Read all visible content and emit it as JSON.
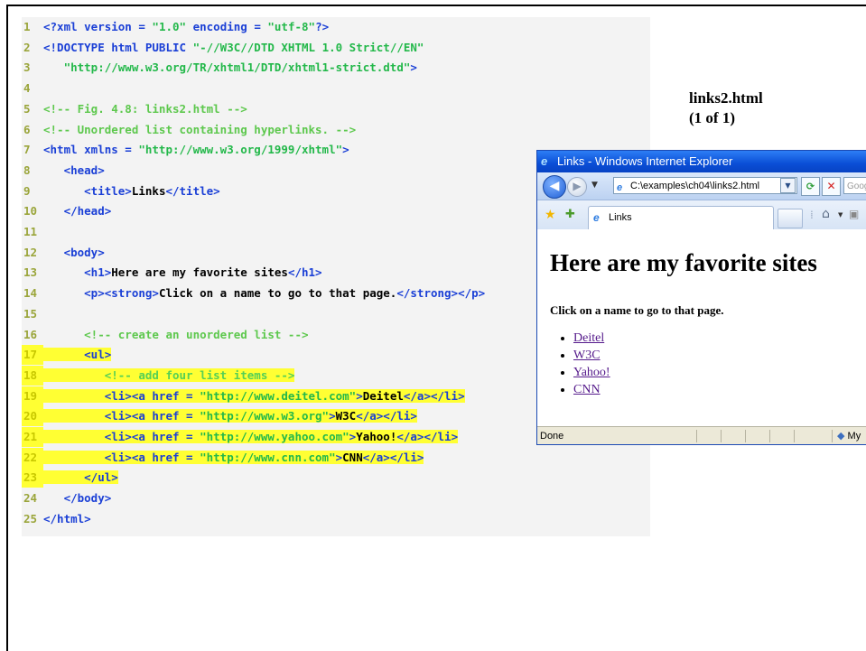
{
  "slide": {
    "title_line1": "links2.html",
    "title_line2": "(1 of 1)"
  },
  "code_lines": [
    {
      "num": "1",
      "hl": false,
      "parts": [
        [
          "tag",
          "<?xml version = "
        ],
        [
          "str",
          "\"1.0\""
        ],
        [
          "tag",
          " encoding = "
        ],
        [
          "str",
          "\"utf-8\""
        ],
        [
          "tag",
          "?>"
        ]
      ]
    },
    {
      "num": "2",
      "hl": false,
      "parts": [
        [
          "tag",
          "<!DOCTYPE html PUBLIC "
        ],
        [
          "str",
          "\"-//W3C//DTD XHTML 1.0 Strict//EN\""
        ]
      ]
    },
    {
      "num": "3",
      "hl": false,
      "parts": [
        [
          "tag",
          "   "
        ],
        [
          "str",
          "\"http://www.w3.org/TR/xhtml1/DTD/xhtml1-strict.dtd\""
        ],
        [
          "tag",
          ">"
        ]
      ]
    },
    {
      "num": "4",
      "hl": false,
      "parts": []
    },
    {
      "num": "5",
      "hl": false,
      "parts": [
        [
          "cmt",
          "<!-- Fig. 4.8: links2.html -->"
        ]
      ]
    },
    {
      "num": "6",
      "hl": false,
      "parts": [
        [
          "cmt",
          "<!-- Unordered list containing hyperlinks. -->"
        ]
      ]
    },
    {
      "num": "7",
      "hl": false,
      "parts": [
        [
          "tag",
          "<html xmlns = "
        ],
        [
          "str",
          "\"http://www.w3.org/1999/xhtml\""
        ],
        [
          "tag",
          ">"
        ]
      ]
    },
    {
      "num": "8",
      "hl": false,
      "parts": [
        [
          "tag",
          "   <head>"
        ]
      ]
    },
    {
      "num": "9",
      "hl": false,
      "parts": [
        [
          "tag",
          "      <title>"
        ],
        [
          "txt",
          "Links"
        ],
        [
          "tag",
          "</title>"
        ]
      ]
    },
    {
      "num": "10",
      "hl": false,
      "parts": [
        [
          "tag",
          "   </head>"
        ]
      ]
    },
    {
      "num": "11",
      "hl": false,
      "parts": []
    },
    {
      "num": "12",
      "hl": false,
      "parts": [
        [
          "tag",
          "   <body>"
        ]
      ]
    },
    {
      "num": "13",
      "hl": false,
      "parts": [
        [
          "tag",
          "      <h1>"
        ],
        [
          "txt",
          "Here are my favorite sites"
        ],
        [
          "tag",
          "</h1>"
        ]
      ]
    },
    {
      "num": "14",
      "hl": false,
      "parts": [
        [
          "tag",
          "      <p><strong>"
        ],
        [
          "txt",
          "Click on a name to go to that page."
        ],
        [
          "tag",
          "</strong></p>"
        ]
      ]
    },
    {
      "num": "15",
      "hl": false,
      "parts": []
    },
    {
      "num": "16",
      "hl": false,
      "parts": [
        [
          "cmt",
          "      <!-- create an unordered list -->"
        ]
      ]
    },
    {
      "num": "17",
      "hl": true,
      "parts": [
        [
          "tag",
          "      <ul>"
        ]
      ]
    },
    {
      "num": "18",
      "hl": true,
      "parts": [
        [
          "cmt",
          "         <!-- add four list items -->"
        ]
      ]
    },
    {
      "num": "19",
      "hl": true,
      "parts": [
        [
          "tag",
          "         <li><a href = "
        ],
        [
          "str",
          "\"http://www.deitel.com\""
        ],
        [
          "tag",
          ">"
        ],
        [
          "txt",
          "Deitel"
        ],
        [
          "tag",
          "</a></li>"
        ]
      ]
    },
    {
      "num": "20",
      "hl": true,
      "parts": [
        [
          "tag",
          "         <li><a href = "
        ],
        [
          "str",
          "\"http://www.w3.org\""
        ],
        [
          "tag",
          ">"
        ],
        [
          "txt",
          "W3C"
        ],
        [
          "tag",
          "</a></li>"
        ]
      ]
    },
    {
      "num": "21",
      "hl": true,
      "parts": [
        [
          "tag",
          "         <li><a href = "
        ],
        [
          "str",
          "\"http://www.yahoo.com\""
        ],
        [
          "tag",
          ">"
        ],
        [
          "txt",
          "Yahoo!"
        ],
        [
          "tag",
          "</a></li>"
        ]
      ]
    },
    {
      "num": "22",
      "hl": true,
      "parts": [
        [
          "tag",
          "         <li><a href = "
        ],
        [
          "str",
          "\"http://www.cnn.com\""
        ],
        [
          "tag",
          ">"
        ],
        [
          "txt",
          "CNN"
        ],
        [
          "tag",
          "</a></li>"
        ]
      ]
    },
    {
      "num": "23",
      "hl": true,
      "parts": [
        [
          "tag",
          "      </ul>"
        ]
      ]
    },
    {
      "num": "24",
      "hl": false,
      "parts": [
        [
          "tag",
          "   </body>"
        ]
      ]
    },
    {
      "num": "25",
      "hl": false,
      "parts": [
        [
          "tag",
          "</html>"
        ]
      ]
    }
  ],
  "browser": {
    "window_title": "Links - Windows Internet Explorer",
    "address": "C:\\examples\\ch04\\links2.html",
    "search_placeholder": "Goog",
    "tab_label": "Links",
    "heading": "Here are my favorite sites",
    "paragraph": "Click on a name to go to that page.",
    "links": [
      "Deitel",
      "W3C",
      "Yahoo!",
      "CNN"
    ],
    "status_text": "Done",
    "zone_text": "My",
    "colors": {
      "visited_link": "#551a8b",
      "titlebar": "#0a4ed6"
    }
  }
}
